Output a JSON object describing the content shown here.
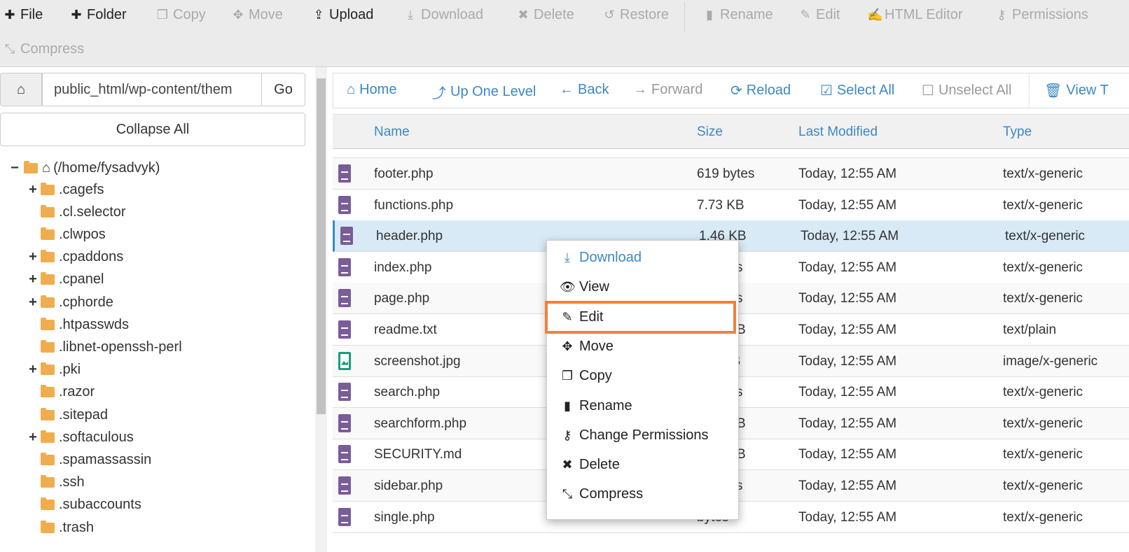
{
  "toolbar": {
    "items": [
      {
        "label": "File",
        "icon": "plus-icon",
        "enabled": true
      },
      {
        "label": "Folder",
        "icon": "plus-icon",
        "enabled": true
      },
      {
        "label": "Copy",
        "icon": "copy-icon",
        "enabled": false
      },
      {
        "label": "Move",
        "icon": "move-icon",
        "enabled": false
      },
      {
        "label": "Upload",
        "icon": "upload-icon",
        "enabled": true
      },
      {
        "label": "Download",
        "icon": "download-icon",
        "enabled": false
      },
      {
        "label": "Delete",
        "icon": "x-icon",
        "enabled": false
      },
      {
        "label": "Restore",
        "icon": "undo-icon",
        "enabled": false
      },
      {
        "label": "Rename",
        "icon": "file-icon",
        "enabled": false
      },
      {
        "label": "Edit",
        "icon": "pencil-icon",
        "enabled": false
      },
      {
        "label": "HTML Editor",
        "icon": "edit-square-icon",
        "enabled": false
      },
      {
        "label": "Permissions",
        "icon": "key-icon",
        "enabled": false
      },
      {
        "label": "Compress",
        "icon": "compress-icon",
        "enabled": false
      }
    ]
  },
  "left": {
    "path_value": "public_html/wp-content/them",
    "go": "Go",
    "collapse_all": "Collapse All",
    "root": "(/home/fysadvyk)",
    "folders": [
      {
        "name": ".cagefs",
        "expandable": true
      },
      {
        "name": ".cl.selector",
        "expandable": false
      },
      {
        "name": ".clwpos",
        "expandable": false
      },
      {
        "name": ".cpaddons",
        "expandable": true
      },
      {
        "name": ".cpanel",
        "expandable": true
      },
      {
        "name": ".cphorde",
        "expandable": true
      },
      {
        "name": ".htpasswds",
        "expandable": false
      },
      {
        "name": ".libnet-openssh-perl",
        "expandable": false
      },
      {
        "name": ".pki",
        "expandable": true
      },
      {
        "name": ".razor",
        "expandable": false
      },
      {
        "name": ".sitepad",
        "expandable": false
      },
      {
        "name": ".softaculous",
        "expandable": true
      },
      {
        "name": ".spamassassin",
        "expandable": false
      },
      {
        "name": ".ssh",
        "expandable": false
      },
      {
        "name": ".subaccounts",
        "expandable": false
      },
      {
        "name": ".trash",
        "expandable": false
      }
    ]
  },
  "nav": {
    "items": [
      {
        "label": "Home",
        "icon": "home-icon",
        "enabled": true
      },
      {
        "label": "Up One Level",
        "icon": "level-up-icon",
        "enabled": true
      },
      {
        "label": "Back",
        "icon": "arrow-left-icon",
        "enabled": true
      },
      {
        "label": "Forward",
        "icon": "arrow-right-icon",
        "enabled": false
      },
      {
        "label": "Reload",
        "icon": "refresh-icon",
        "enabled": true
      },
      {
        "label": "Select All",
        "icon": "checkbox-checked-icon",
        "enabled": true
      },
      {
        "label": "Unselect All",
        "icon": "checkbox-empty-icon",
        "enabled": false
      },
      {
        "label": "View T",
        "icon": "trash-icon",
        "enabled": true
      }
    ]
  },
  "table": {
    "headers": {
      "name": "Name",
      "size": "Size",
      "modified": "Last Modified",
      "type": "Type"
    },
    "rows": [
      {
        "name": "footer.php",
        "size": "619 bytes",
        "modified": "Today, 12:55 AM",
        "type": "text/x-generic",
        "icon": "file-text"
      },
      {
        "name": "functions.php",
        "size": "7.73 KB",
        "modified": "Today, 12:55 AM",
        "type": "text/x-generic",
        "icon": "file-text"
      },
      {
        "name": "header.php",
        "size": "1.46 KB",
        "modified": "Today, 12:55 AM",
        "type": "text/x-generic",
        "icon": "file-text",
        "selected": true
      },
      {
        "name": "index.php",
        "size": "tes",
        "modified": "Today, 12:55 AM",
        "type": "text/x-generic",
        "icon": "file-text"
      },
      {
        "name": "page.php",
        "size": "tes",
        "modified": "Today, 12:55 AM",
        "type": "text/x-generic",
        "icon": "file-text"
      },
      {
        "name": "readme.txt",
        "size": "B",
        "modified": "Today, 12:55 AM",
        "type": "text/plain",
        "icon": "file-text"
      },
      {
        "name": "screenshot.jpg",
        "size": "KB",
        "modified": "Today, 12:55 AM",
        "type": "image/x-generic",
        "icon": "file-image"
      },
      {
        "name": "search.php",
        "size": "tes",
        "modified": "Today, 12:55 AM",
        "type": "text/x-generic",
        "icon": "file-text"
      },
      {
        "name": "searchform.php",
        "size": "B",
        "modified": "Today, 12:55 AM",
        "type": "text/x-generic",
        "icon": "file-text"
      },
      {
        "name": "SECURITY.md",
        "size": "B",
        "modified": "Today, 12:55 AM",
        "type": "text/x-generic",
        "icon": "file-text"
      },
      {
        "name": "sidebar.php",
        "size": "tes",
        "modified": "Today, 12:55 AM",
        "type": "text/x-generic",
        "icon": "file-text"
      },
      {
        "name": "single.php",
        "size": "bytes",
        "modified": "Today, 12:55 AM",
        "type": "text/x-generic",
        "icon": "file-text"
      }
    ]
  },
  "context_menu": {
    "items": [
      {
        "label": "Download",
        "icon": "download-icon"
      },
      {
        "label": "View",
        "icon": "eye-icon"
      },
      {
        "label": "Edit",
        "icon": "pencil-icon",
        "highlighted": true
      },
      {
        "label": "Move",
        "icon": "move-icon"
      },
      {
        "label": "Copy",
        "icon": "copy-icon"
      },
      {
        "label": "Rename",
        "icon": "file-icon"
      },
      {
        "label": "Change Permissions",
        "icon": "key-icon"
      },
      {
        "label": "Delete",
        "icon": "x-icon"
      },
      {
        "label": "Compress",
        "icon": "compress-icon"
      }
    ]
  },
  "colors": {
    "accent": "#3b88c7",
    "highlight": "#f0813a",
    "folder": "#f0ad4e",
    "file": "#7a5c99"
  }
}
